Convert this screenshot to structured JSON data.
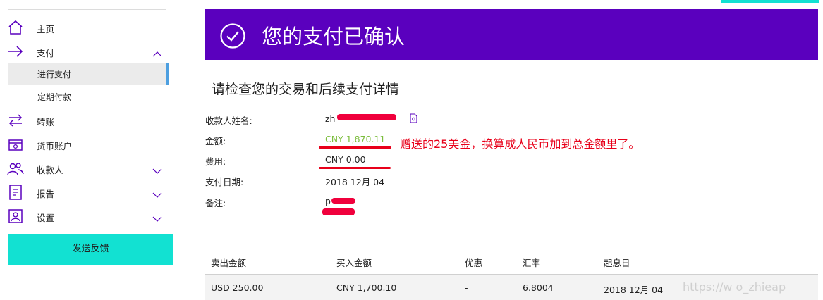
{
  "sidebar": {
    "items": [
      {
        "label": "主页",
        "icon": "home-icon"
      },
      {
        "label": "支付",
        "icon": "arrow-right-icon",
        "expanded": true
      },
      {
        "label": "转账",
        "icon": "transfer-icon"
      },
      {
        "label": "货币账户",
        "icon": "wallet-icon"
      },
      {
        "label": "收款人",
        "icon": "people-icon"
      },
      {
        "label": "报告",
        "icon": "report-icon"
      },
      {
        "label": "设置",
        "icon": "settings-icon"
      }
    ],
    "sub_items": [
      {
        "label": "进行支付",
        "active": true
      },
      {
        "label": "定期付款",
        "active": false
      }
    ],
    "feedback_label": "发送反馈"
  },
  "banner": {
    "title": "您的支付已确认",
    "background": "#5a00be"
  },
  "details": {
    "heading": "请检查您的交易和后续支付详情",
    "payee_label": "收款人姓名:",
    "payee_value": "zh",
    "amount_label": "金额:",
    "amount_value": "CNY 1,870.11",
    "fee_label": "费用:",
    "fee_value": "CNY 0.00",
    "date_label": "支付日期:",
    "date_value": "2018 12月 04",
    "note_label": "备注:",
    "note_value": "p"
  },
  "annotation": "赠送的25美金，换算成人民币加到总金额里了。",
  "table": {
    "headers": [
      "卖出金额",
      "买入金额",
      "优惠",
      "汇率",
      "起息日"
    ],
    "row": [
      "USD 250.00",
      "CNY 1,700.10",
      "-",
      "6.8004",
      "2018 12月 04"
    ]
  },
  "watermark": "https://w         o_zhieap",
  "colors": {
    "accent": "#12e1d2",
    "banner": "#5a00be",
    "amount": "#7cbd3d",
    "annotation": "#e8001a"
  }
}
